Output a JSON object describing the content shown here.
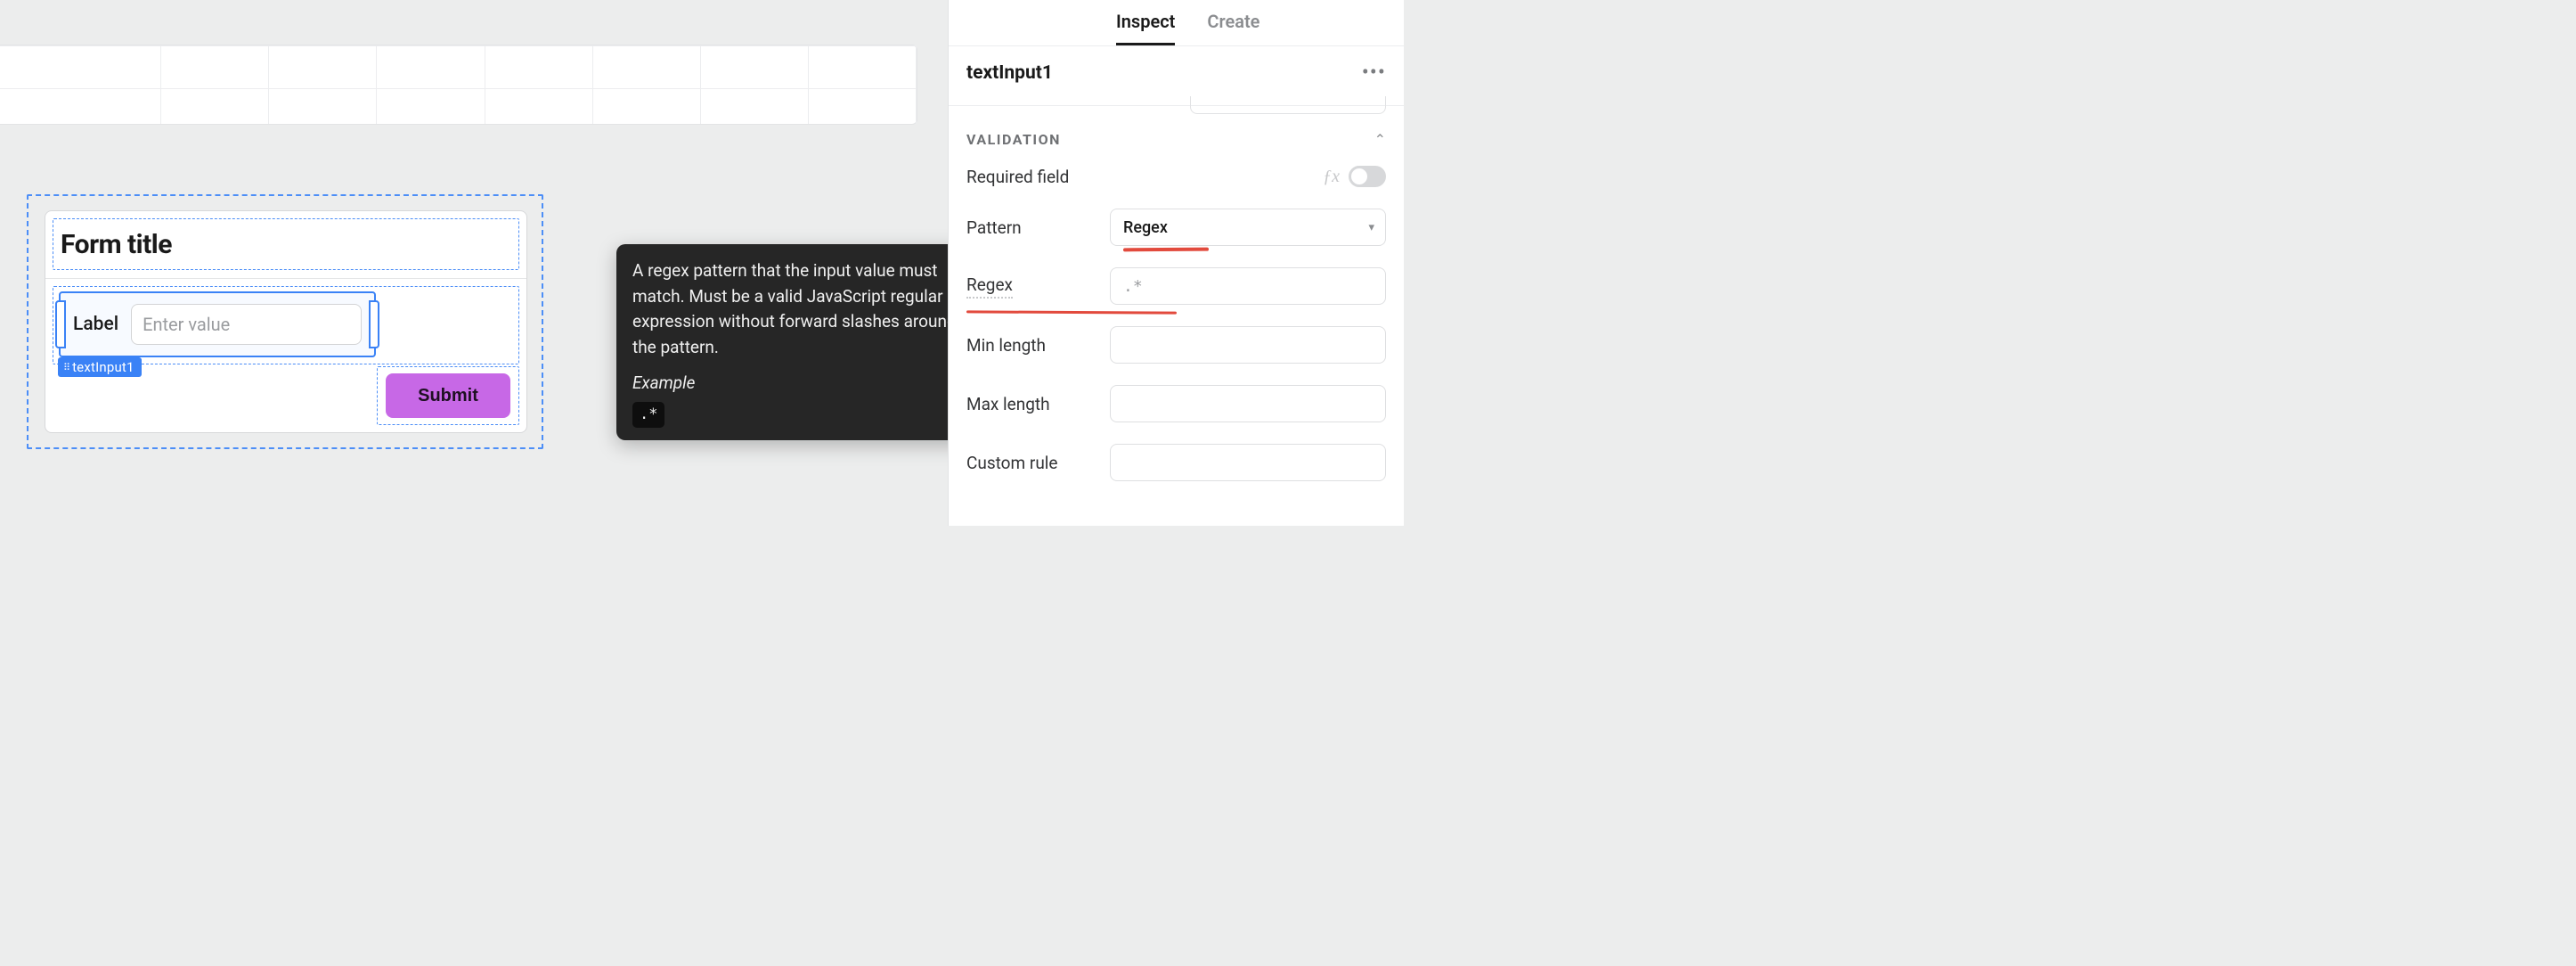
{
  "panel": {
    "tabs": {
      "inspect": "Inspect",
      "create": "Create"
    },
    "component_name": "textInput1",
    "section": "VALIDATION",
    "rows": {
      "required": "Required field",
      "pattern": "Pattern",
      "pattern_value": "Regex",
      "regex": "Regex",
      "regex_placeholder": ".*",
      "min_len": "Min length",
      "max_len": "Max length",
      "custom_rule": "Custom rule"
    },
    "fx": "ƒx"
  },
  "form": {
    "title": "Form title",
    "input_label": "Label",
    "input_placeholder": "Enter value",
    "component_tag": "textInput1",
    "submit": "Submit"
  },
  "tooltip": {
    "body": "A regex pattern that the input value must match. Must be a valid JavaScript regular expression without forward slashes around the pattern.",
    "example_label": "Example",
    "example_code": ".*"
  }
}
